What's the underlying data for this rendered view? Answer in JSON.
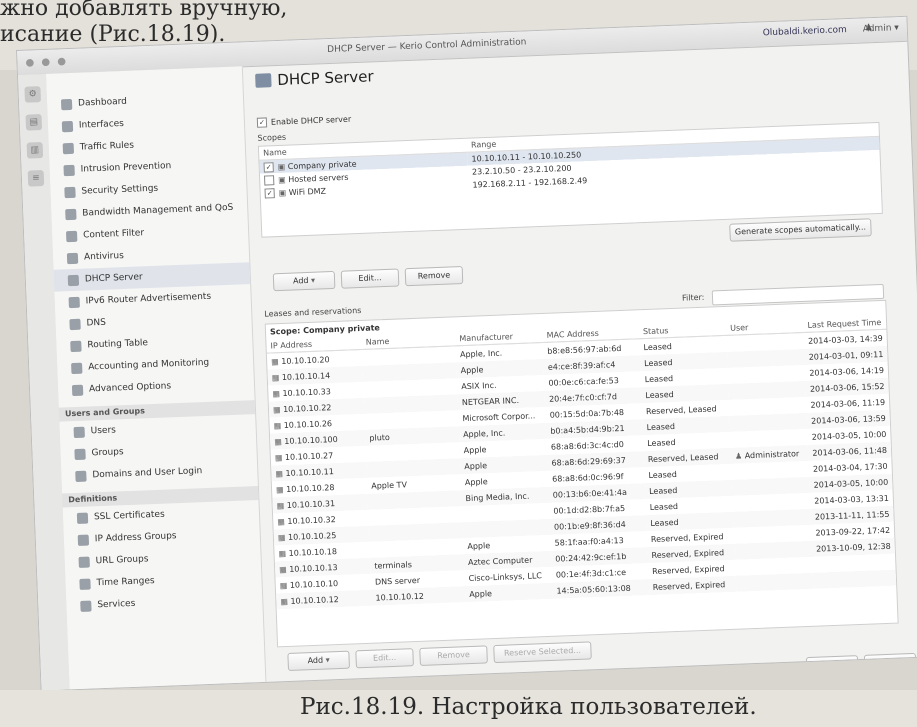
{
  "book": {
    "top_line1": "жно добавлять вручную,",
    "top_line2": "исание (Рис.18.19).",
    "caption": "Рис.18.19. Настройка пользователей."
  },
  "window": {
    "title": "DHCP Server — Kerio Control Administration",
    "user": "Olubaldi.kerio.com",
    "help": "Admin ▾"
  },
  "sidebar": {
    "items": [
      {
        "label": "Dashboard"
      },
      {
        "label": "Interfaces"
      },
      {
        "label": "Traffic Rules"
      },
      {
        "label": "Intrusion Prevention"
      },
      {
        "label": "Security Settings"
      },
      {
        "label": "Bandwidth Management and QoS"
      },
      {
        "label": "Content Filter"
      },
      {
        "label": "Antivirus"
      },
      {
        "label": "DHCP Server"
      },
      {
        "label": "IPv6 Router Advertisements"
      },
      {
        "label": "DNS"
      },
      {
        "label": "Routing Table"
      },
      {
        "label": "Accounting and Monitoring"
      },
      {
        "label": "Advanced Options"
      }
    ],
    "group1_title": "Users and Groups",
    "group1": [
      {
        "label": "Users"
      },
      {
        "label": "Groups"
      },
      {
        "label": "Domains and User Login"
      }
    ],
    "group2_title": "Definitions",
    "group2": [
      {
        "label": "SSL Certificates"
      },
      {
        "label": "IP Address Groups"
      },
      {
        "label": "URL Groups"
      },
      {
        "label": "Time Ranges"
      },
      {
        "label": "Services"
      }
    ]
  },
  "main": {
    "title": "DHCP Server",
    "enable_label": "Enable DHCP server",
    "scopes_label": "Scopes",
    "scope_cols": {
      "name": "Name",
      "range": "Range"
    },
    "scopes": [
      {
        "name": "Company private",
        "range": "10.10.10.11 - 10.10.10.250"
      },
      {
        "name": "Hosted servers",
        "range": "23.2.10.50 - 23.2.10.200"
      },
      {
        "name": "WiFi DMZ",
        "range": "192.168.2.11 - 192.168.2.49"
      }
    ],
    "generate_label": "Generate scopes automatically...",
    "add_label": "Add",
    "edit_label": "Edit...",
    "remove_label": "Remove",
    "leases_label": "Leases and reservations",
    "filter_label": "Filter:",
    "group_label": "Scope: Company private",
    "lease_cols": {
      "ip": "IP Address",
      "name": "Name",
      "manufacturer": "Manufacturer",
      "mac": "MAC Address",
      "status": "Status",
      "user": "User",
      "last": "Last Request Time"
    },
    "leases": [
      {
        "ip": "10.10.10.20",
        "name": "",
        "manufacturer": "Apple, Inc.",
        "mac": "b8:e8:56:97:ab:6d",
        "status": "Leased",
        "user": "",
        "last": "2014-03-03, 14:39"
      },
      {
        "ip": "10.10.10.14",
        "name": "",
        "manufacturer": "Apple",
        "mac": "e4:ce:8f:39:af:c4",
        "status": "Leased",
        "user": "",
        "last": "2014-03-01, 09:11"
      },
      {
        "ip": "10.10.10.33",
        "name": "",
        "manufacturer": "ASIX Inc.",
        "mac": "00:0e:c6:ca:fe:53",
        "status": "Leased",
        "user": "",
        "last": "2014-03-06, 14:19"
      },
      {
        "ip": "10.10.10.22",
        "name": "",
        "manufacturer": "NETGEAR INC.",
        "mac": "20:4e:7f:c0:cf:7d",
        "status": "Leased",
        "user": "",
        "last": "2014-03-06, 15:52"
      },
      {
        "ip": "10.10.10.26",
        "name": "",
        "manufacturer": "Microsoft Corpor...",
        "mac": "00:15:5d:0a:7b:48",
        "status": "Reserved, Leased",
        "user": "",
        "last": "2014-03-06, 11:19"
      },
      {
        "ip": "10.10.10.100",
        "name": "pluto",
        "manufacturer": "Apple, Inc.",
        "mac": "b0:a4:5b:d4:9b:21",
        "status": "Leased",
        "user": "",
        "last": "2014-03-06, 13:59"
      },
      {
        "ip": "10.10.10.27",
        "name": "",
        "manufacturer": "Apple",
        "mac": "68:a8:6d:3c:4c:d0",
        "status": "Leased",
        "user": "",
        "last": "2014-03-05, 10:00"
      },
      {
        "ip": "10.10.10.11",
        "name": "",
        "manufacturer": "Apple",
        "mac": "68:a8:6d:29:69:37",
        "status": "Reserved, Leased",
        "user": "Administrator",
        "last": "2014-03-06, 11:48"
      },
      {
        "ip": "10.10.10.28",
        "name": "Apple TV",
        "manufacturer": "Apple",
        "mac": "68:a8:6d:0c:96:9f",
        "status": "Leased",
        "user": "",
        "last": "2014-03-04, 17:30"
      },
      {
        "ip": "10.10.10.31",
        "name": "",
        "manufacturer": "Bing Media, Inc.",
        "mac": "00:13:b6:0e:41:4a",
        "status": "Leased",
        "user": "",
        "last": "2014-03-05, 10:00"
      },
      {
        "ip": "10.10.10.32",
        "name": "",
        "manufacturer": "",
        "mac": "00:1d:d2:8b:7f:a5",
        "status": "Leased",
        "user": "",
        "last": "2014-03-03, 13:31"
      },
      {
        "ip": "10.10.10.25",
        "name": "",
        "manufacturer": "",
        "mac": "00:1b:e9:8f:36:d4",
        "status": "Leased",
        "user": "",
        "last": "2013-11-11, 11:55"
      },
      {
        "ip": "10.10.10.18",
        "name": "",
        "manufacturer": "Apple",
        "mac": "58:1f:aa:f0:a4:13",
        "status": "Reserved, Expired",
        "user": "",
        "last": "2013-09-22, 17:42"
      },
      {
        "ip": "10.10.10.13",
        "name": "terminals",
        "manufacturer": "Aztec Computer",
        "mac": "00:24:42:9c:ef:1b",
        "status": "Reserved, Expired",
        "user": "",
        "last": "2013-10-09, 12:38"
      },
      {
        "ip": "10.10.10.10",
        "name": "DNS server",
        "manufacturer": "Cisco-Linksys, LLC",
        "mac": "00:1e:4f:3d:c1:ce",
        "status": "Reserved, Expired",
        "user": "",
        "last": ""
      },
      {
        "ip": "10.10.10.12",
        "name": "10.10.10.12",
        "manufacturer": "Apple",
        "mac": "14:5a:05:60:13:08",
        "status": "Reserved, Expired",
        "user": "",
        "last": ""
      }
    ],
    "lease_buttons": {
      "add": "Add",
      "edit": "Edit...",
      "remove": "Remove",
      "reserve": "Reserve Selected..."
    },
    "apply_label": "Apply",
    "reset_label": "Reset"
  }
}
